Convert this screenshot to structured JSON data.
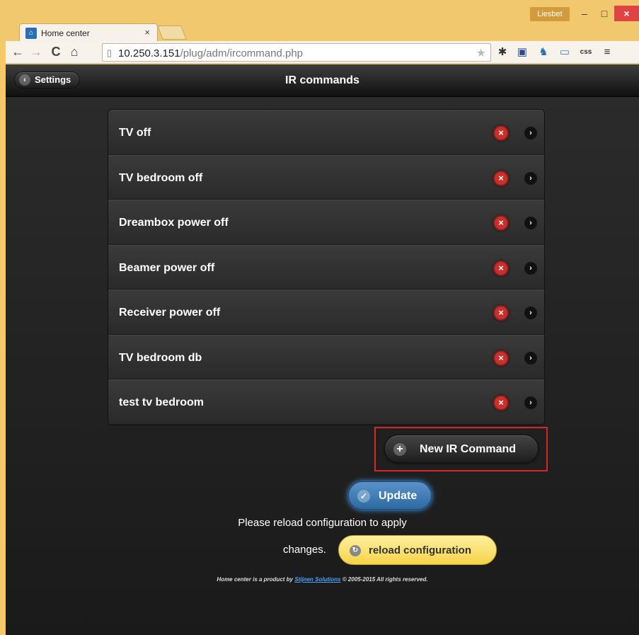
{
  "window": {
    "user": "Liesbet",
    "minimize": "–",
    "maximize": "□",
    "close": "×"
  },
  "tab": {
    "title": "Home center",
    "close": "×"
  },
  "browser": {
    "url_host": "10.250.3.151",
    "url_path": "/plug/adm/ircommand.php"
  },
  "header": {
    "back_label": "Settings",
    "title": "IR commands"
  },
  "commands": [
    {
      "label": "TV off"
    },
    {
      "label": "TV bedroom off"
    },
    {
      "label": "Dreambox power off"
    },
    {
      "label": "Beamer power off"
    },
    {
      "label": "Receiver power off"
    },
    {
      "label": "TV bedroom db"
    },
    {
      "label": "test tv bedroom"
    }
  ],
  "actions": {
    "new_label": "New IR Command",
    "update_label": "Update",
    "reload_message": "Please reload configuration to apply",
    "changes_text": "changes.",
    "reload_label": "reload configuration"
  },
  "footer": {
    "prefix": "Home center is a product by",
    "company": "Stijnen Solutions",
    "suffix": "© 2005-2015 All rights reserved."
  },
  "colors": {
    "window_frame": "#f1c86e",
    "delete": "#c9302c",
    "update": "#2c6aa2",
    "reload": "#f4d348",
    "highlight": "#d9262b"
  }
}
